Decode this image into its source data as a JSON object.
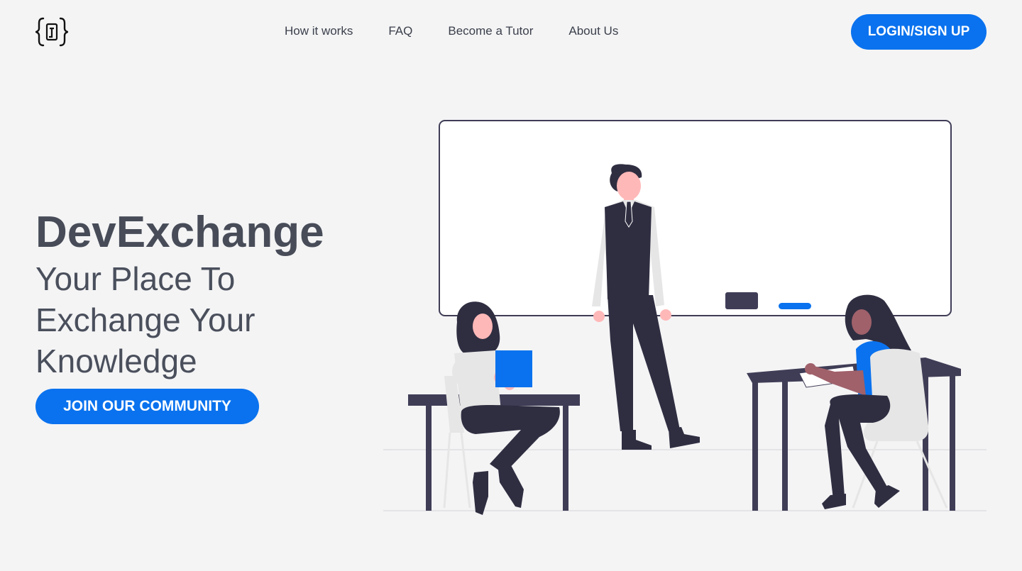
{
  "header": {
    "logo_icon": "curly-braces-logo-icon",
    "nav": [
      {
        "label": "How it works"
      },
      {
        "label": "FAQ"
      },
      {
        "label": "Become a Tutor"
      },
      {
        "label": "About Us"
      }
    ],
    "login_label": "LOGIN/SIGN UP"
  },
  "hero": {
    "title": "DevExchange",
    "subtitle": "Your Place To Exchange Your Knowledge",
    "cta_label": "JOIN OUR COMMUNITY",
    "illustration_icon": "classroom-illustration-icon"
  },
  "colors": {
    "accent": "#0a72ee",
    "background": "#f4f4f5",
    "text": "#474c58",
    "dark_figure": "#2f2e41"
  }
}
